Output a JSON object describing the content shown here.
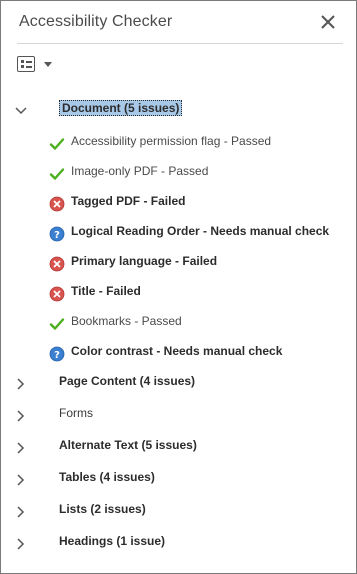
{
  "panel": {
    "title": "Accessibility Checker"
  },
  "icons": {
    "close": "close-icon",
    "options": "list-options-icon",
    "passed": "green-checkmark-icon",
    "failed": "red-x-circle-icon",
    "manual": "blue-question-circle-icon"
  },
  "colors": {
    "selected_bg": "#a8c8e8",
    "passed": "#4caf1e",
    "failed": "#d9534f",
    "manual": "#3b7fd1"
  },
  "document": {
    "label": "Document (5 issues)",
    "expanded": true,
    "items": [
      {
        "label": "Accessibility permission flag - Passed",
        "status": "passed"
      },
      {
        "label": "Image-only PDF - Passed",
        "status": "passed"
      },
      {
        "label": "Tagged PDF - Failed",
        "status": "failed"
      },
      {
        "label": "Logical Reading Order - Needs manual check",
        "status": "manual"
      },
      {
        "label": "Primary language - Failed",
        "status": "failed"
      },
      {
        "label": "Title - Failed",
        "status": "failed"
      },
      {
        "label": "Bookmarks - Passed",
        "status": "passed"
      },
      {
        "label": "Color contrast - Needs manual check",
        "status": "manual"
      }
    ]
  },
  "categories": [
    {
      "label": "Page Content (4 issues)",
      "bold": true
    },
    {
      "label": "Forms",
      "bold": false
    },
    {
      "label": "Alternate Text (5 issues)",
      "bold": true
    },
    {
      "label": "Tables (4 issues)",
      "bold": true
    },
    {
      "label": "Lists (2 issues)",
      "bold": true
    },
    {
      "label": "Headings (1 issue)",
      "bold": true
    }
  ]
}
